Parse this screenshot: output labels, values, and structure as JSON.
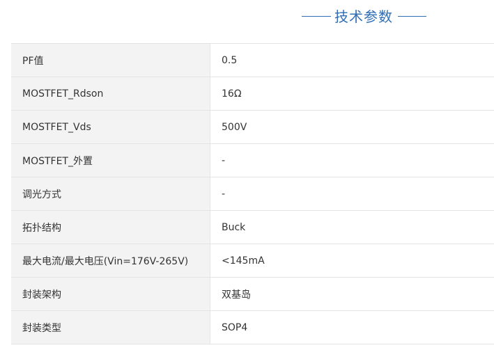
{
  "section": {
    "title": "技术参数"
  },
  "specs": [
    {
      "label": "PF值",
      "value": "0.5"
    },
    {
      "label": "MOSTFET_Rdson",
      "value": "16Ω"
    },
    {
      "label": "MOSTFET_Vds",
      "value": "500V"
    },
    {
      "label": "MOSTFET_外置",
      "value": "-"
    },
    {
      "label": "调光方式",
      "value": "-"
    },
    {
      "label": "拓扑结构",
      "value": "Buck"
    },
    {
      "label": "最大电流/最大电压(Vin=176V-265V)",
      "value": "<145mA"
    },
    {
      "label": "封装架构",
      "value": "双基岛"
    },
    {
      "label": "封装类型",
      "value": "SOP4"
    }
  ]
}
